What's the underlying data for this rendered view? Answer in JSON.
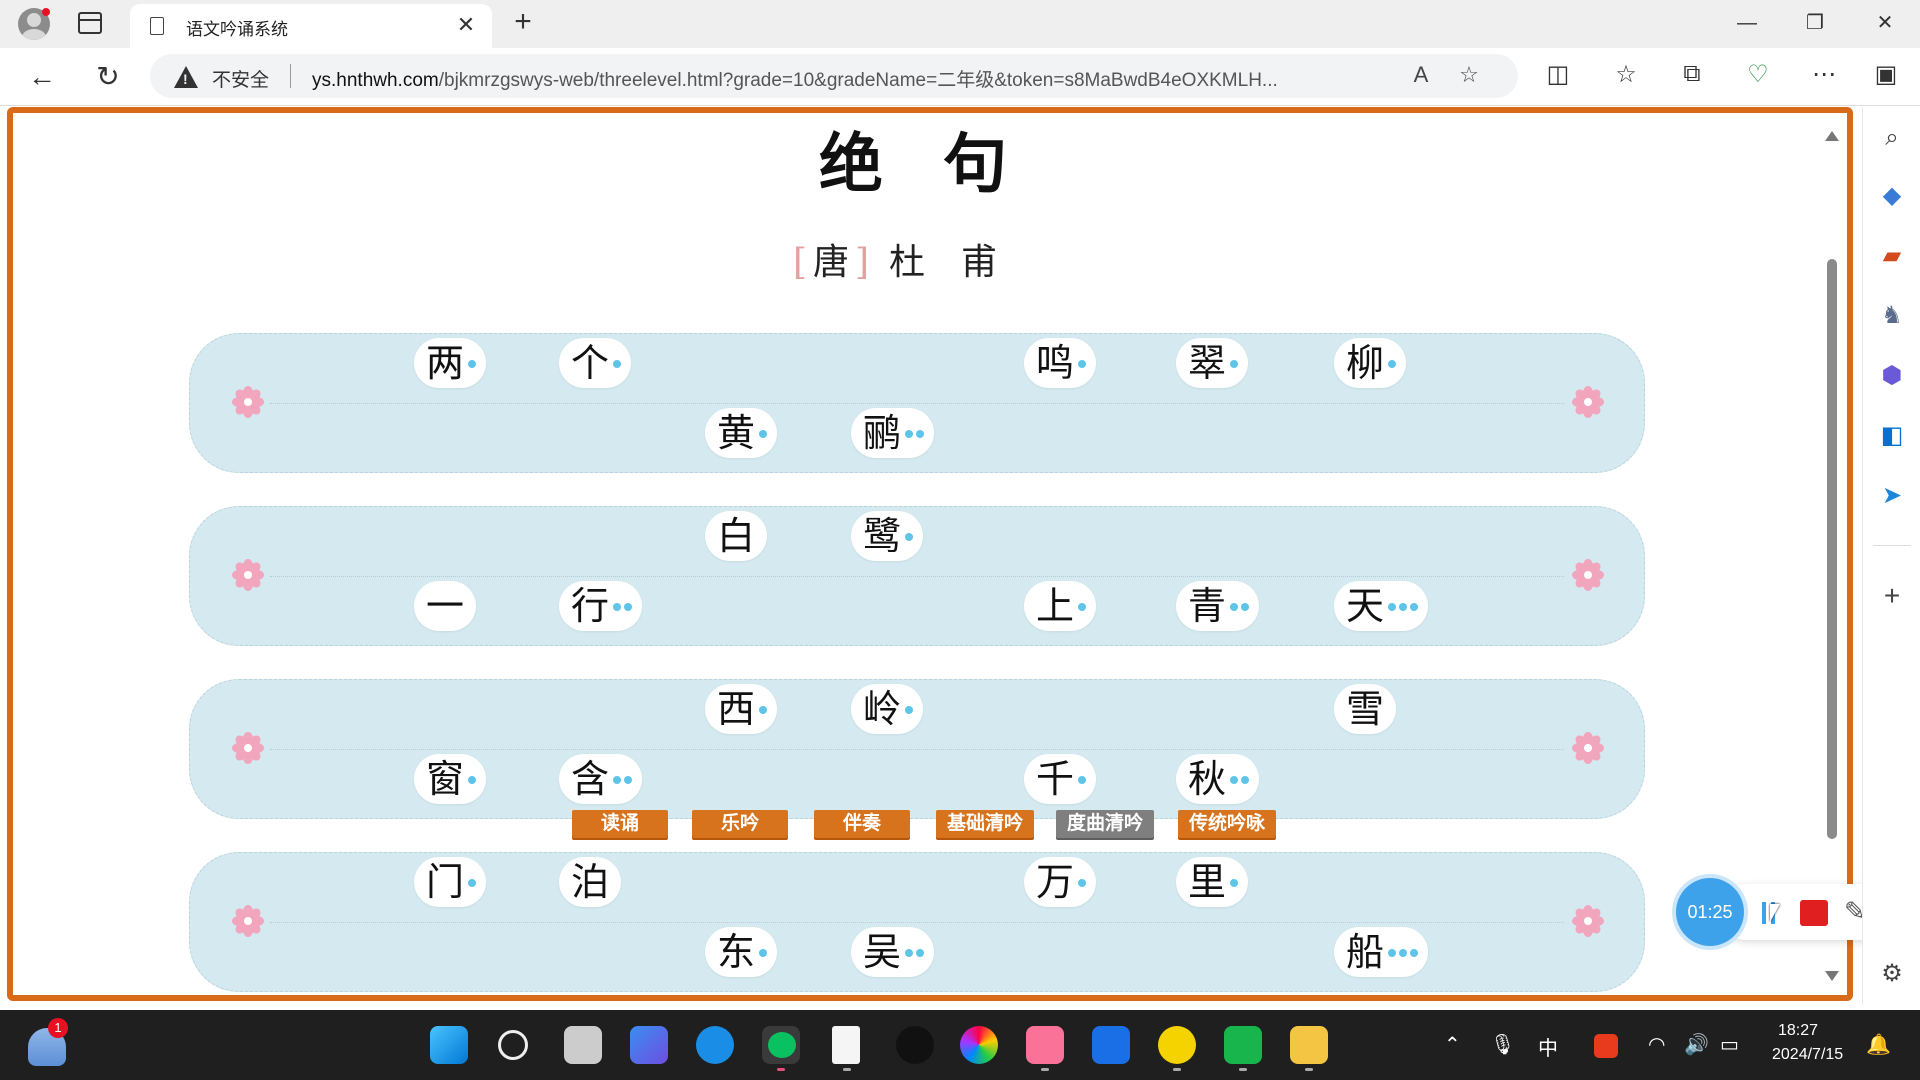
{
  "browser": {
    "tab_title": "语文吟诵系统",
    "tab_close": "✕",
    "new_tab": "+",
    "security_label": "不安全",
    "url_domain": "ys.hnthwh.com",
    "url_path": "/bjkmrzgswys-web/threelevel.html?grade=10&gradeName=二年级&token=s8MaBwdB4eOXKMLH...",
    "read_aloud": "A",
    "favorite": "☆"
  },
  "poem": {
    "title": "绝句",
    "title_chars": [
      "绝",
      "句"
    ],
    "dynasty_open": "[",
    "dynasty": "唐",
    "dynasty_close": "]",
    "author": "杜甫",
    "lines": [
      {
        "upper": [
          {
            "char": "两",
            "tone_dots": 1
          },
          {
            "char": "个",
            "tone_dots": 1
          },
          {
            "char": "鸣",
            "tone_dots": 1
          },
          {
            "char": "翠",
            "tone_dots": 1
          },
          {
            "char": "柳",
            "tone_dots": 1
          }
        ],
        "lower": [
          {
            "char": "黄",
            "tone_dots": 1
          },
          {
            "char": "鹂",
            "tone_dots": 2
          }
        ]
      },
      {
        "upper": [
          {
            "char": "白",
            "tone_dots": 0
          },
          {
            "char": "鹭",
            "tone_dots": 1
          }
        ],
        "lower": [
          {
            "char": "一",
            "tone_dots": 0
          },
          {
            "char": "行",
            "tone_dots": 2
          },
          {
            "char": "上",
            "tone_dots": 1
          },
          {
            "char": "青",
            "tone_dots": 2
          },
          {
            "char": "天",
            "tone_dots": 3
          }
        ]
      },
      {
        "upper": [
          {
            "char": "西",
            "tone_dots": 1
          },
          {
            "char": "岭",
            "tone_dots": 1
          },
          {
            "char": "雪",
            "tone_dots": 0
          }
        ],
        "lower": [
          {
            "char": "窗",
            "tone_dots": 1
          },
          {
            "char": "含",
            "tone_dots": 2
          },
          {
            "char": "千",
            "tone_dots": 1
          },
          {
            "char": "秋",
            "tone_dots": 2
          }
        ]
      },
      {
        "upper": [
          {
            "char": "门",
            "tone_dots": 1
          },
          {
            "char": "泊",
            "tone_dots": 0
          },
          {
            "char": "万",
            "tone_dots": 1
          },
          {
            "char": "里",
            "tone_dots": 1
          }
        ],
        "lower": [
          {
            "char": "东",
            "tone_dots": 1
          },
          {
            "char": "吴",
            "tone_dots": 2
          },
          {
            "char": "船",
            "tone_dots": 3
          }
        ]
      }
    ]
  },
  "modes": [
    "读诵",
    "乐吟",
    "伴奏",
    "基础清吟",
    "度曲清吟",
    "传统吟咏"
  ],
  "recorder": {
    "timer": "01:25"
  },
  "taskbar": {
    "weather_badge": "1",
    "ime": "中",
    "time": "18:27",
    "date": "2024/7/15"
  },
  "colors": {
    "frame_border": "#d86a18",
    "band": "#d4e9f0",
    "tone_dot": "#5ec5e8",
    "mode_button": "#d8731d",
    "mode_button_gray": "#7f7f7f",
    "record_stop": "#e02020",
    "timer": "#3ea2ea"
  }
}
